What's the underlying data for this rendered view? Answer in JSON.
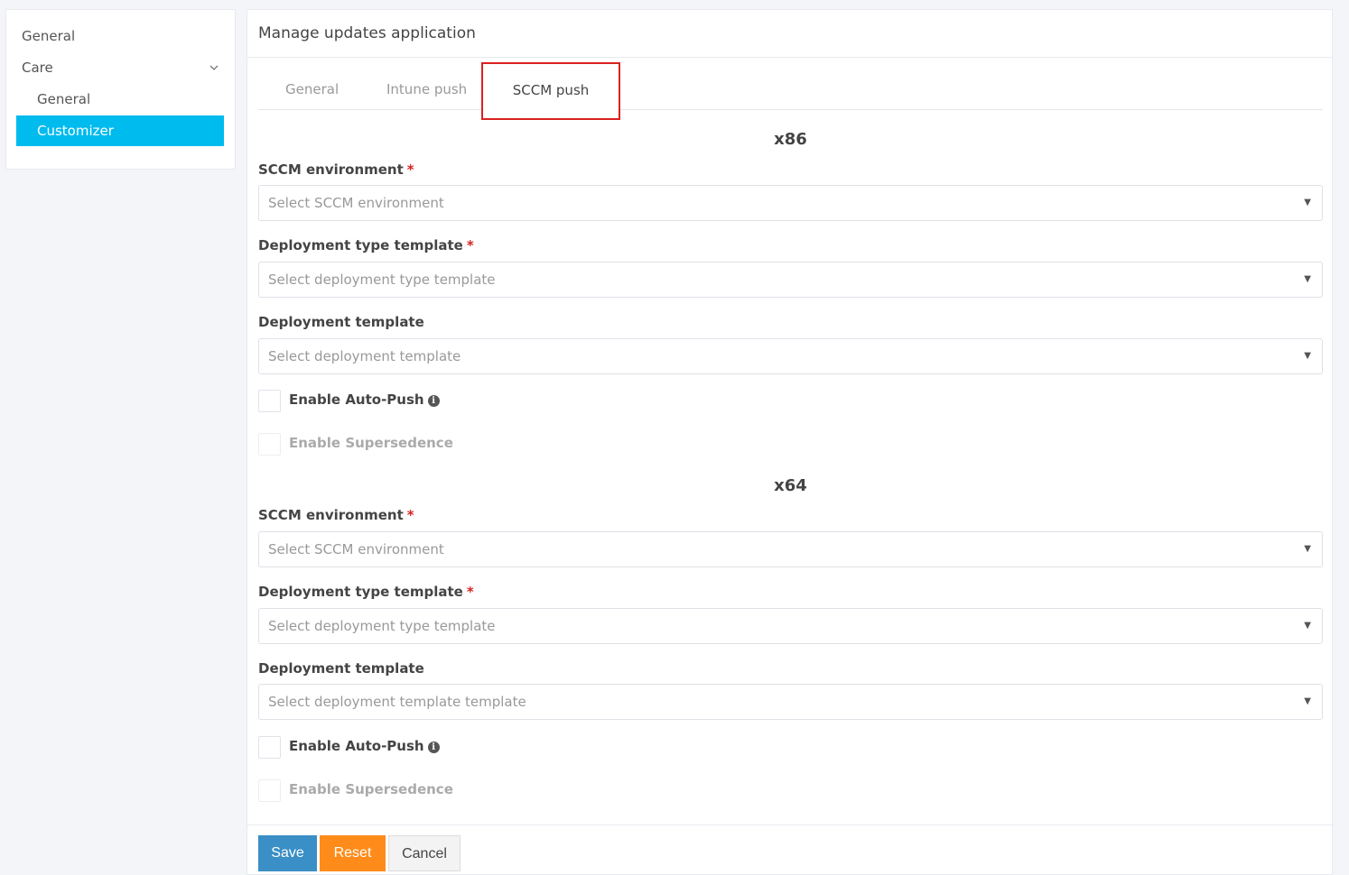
{
  "sidebar": {
    "items": [
      {
        "label": "General"
      },
      {
        "label": "Care"
      },
      {
        "label": "General"
      },
      {
        "label": "Customizer"
      }
    ]
  },
  "panel": {
    "title": "Manage updates application",
    "tabs": [
      {
        "label": "General"
      },
      {
        "label": "Intune push"
      },
      {
        "label": "SCCM push"
      }
    ]
  },
  "x86": {
    "heading": "x86",
    "sccm_label": "SCCM environment",
    "sccm_placeholder": "Select SCCM environment",
    "dtt_label": "Deployment type template",
    "dtt_placeholder": "Select deployment type template",
    "dt_label": "Deployment template",
    "dt_placeholder": "Select deployment template",
    "autopush_label": "Enable Auto-Push",
    "supersedence_label": "Enable Supersedence"
  },
  "x64": {
    "heading": "x64",
    "sccm_label": "SCCM environment",
    "sccm_placeholder": "Select SCCM environment",
    "dtt_label": "Deployment type template",
    "dtt_placeholder": "Select deployment type template",
    "dt_label": "Deployment template",
    "dt_placeholder": "Select deployment template template",
    "autopush_label": "Enable Auto-Push",
    "supersedence_label": "Enable Supersedence"
  },
  "required_mark": "*",
  "footer": {
    "save": "Save",
    "reset": "Reset",
    "cancel": "Cancel"
  },
  "colors": {
    "active_nav": "#00bbee",
    "save": "#3a8fc6",
    "reset": "#ff8c1a",
    "highlight_box": "#d9221f"
  }
}
